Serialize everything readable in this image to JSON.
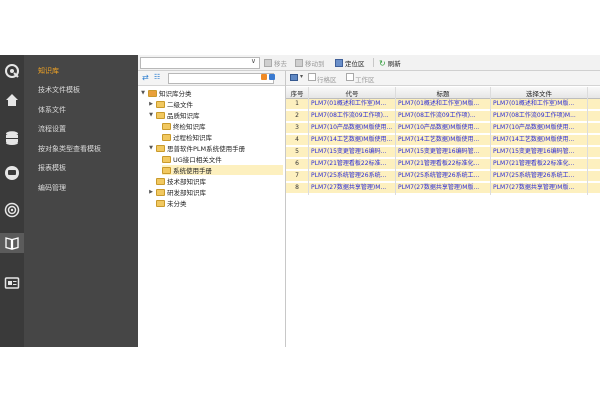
{
  "sidebar": {
    "items": [
      {
        "label": "知识库",
        "active": true
      },
      {
        "label": "技术文件模板"
      },
      {
        "label": "体系文件"
      },
      {
        "label": "流程设置"
      },
      {
        "label": "按对象类型查看模板"
      },
      {
        "label": "报表模板"
      },
      {
        "label": "编码管理"
      }
    ],
    "icons": [
      "brand-icon",
      "home-icon",
      "database-icon",
      "chat-icon",
      "broadcast-icon",
      "book-icon",
      "id-card-icon"
    ]
  },
  "toolbar": {
    "move_up": "移去",
    "move_to": "移动到",
    "locate": "定位区",
    "refresh": "刷新"
  },
  "filter": {
    "row_group": "行格区",
    "work_area": "工作区"
  },
  "tree": [
    {
      "label": "知识库分类",
      "level": 0,
      "expanded": true
    },
    {
      "label": "二级文件",
      "level": 1,
      "expanded": false
    },
    {
      "label": "品质知识库",
      "level": 1,
      "expanded": true
    },
    {
      "label": "终检知识库",
      "level": 2
    },
    {
      "label": "过程检知识库",
      "level": 2
    },
    {
      "label": "思普软件PLM系统使用手册",
      "level": 1,
      "expanded": true
    },
    {
      "label": "UG接口相关文件",
      "level": 2
    },
    {
      "label": "系统使用手册",
      "level": 2,
      "selected": true
    },
    {
      "label": "技术部知识库",
      "level": 1
    },
    {
      "label": "研发部知识库",
      "level": 1,
      "expanded": false
    },
    {
      "label": "未分类",
      "level": 1
    }
  ],
  "grid": {
    "columns": [
      "序号",
      "代号",
      "标题",
      "选择文件"
    ],
    "rows": [
      [
        "1",
        "PLM7(01概述和工作室)M...",
        "PLM7(01概述和工作室)M版...",
        "PLM7(01概述和工作室)M版..."
      ],
      [
        "2",
        "PLM7(08工作流09工作项)...",
        "PLM7(08工作流09工作项)...",
        "PLM7(08工作流09工作项)M..."
      ],
      [
        "3",
        "PLM7(10产品数据)M版使用...",
        "PLM7(10产品数据)M版使用...",
        "PLM7(10产品数据)M版使用..."
      ],
      [
        "4",
        "PLM7(14工艺数据)M版使用...",
        "PLM7(14工艺数据)M版使用...",
        "PLM7(14工艺数据)M版使用..."
      ],
      [
        "5",
        "PLM7(15变更管理16编码...",
        "PLM7(15变更管理16编码管...",
        "PLM7(15变更管理16编码管..."
      ],
      [
        "6",
        "PLM7(21管理看板22标准...",
        "PLM7(21管理看板22标准化...",
        "PLM7(21管理看板22标准化..."
      ],
      [
        "7",
        "PLM7(25系统管理26系统...",
        "PLM7(25系统管理26系统工...",
        "PLM7(25系统管理26系统工..."
      ],
      [
        "8",
        "PLM7(27数据共享管理)M...",
        "PLM7(27数据共享管理)M版...",
        "PLM7(27数据共享管理)M版..."
      ]
    ]
  },
  "colors": {
    "accent": "#f6a623",
    "link": "#2b2bd6",
    "row_selected": "#fdf0bf"
  }
}
